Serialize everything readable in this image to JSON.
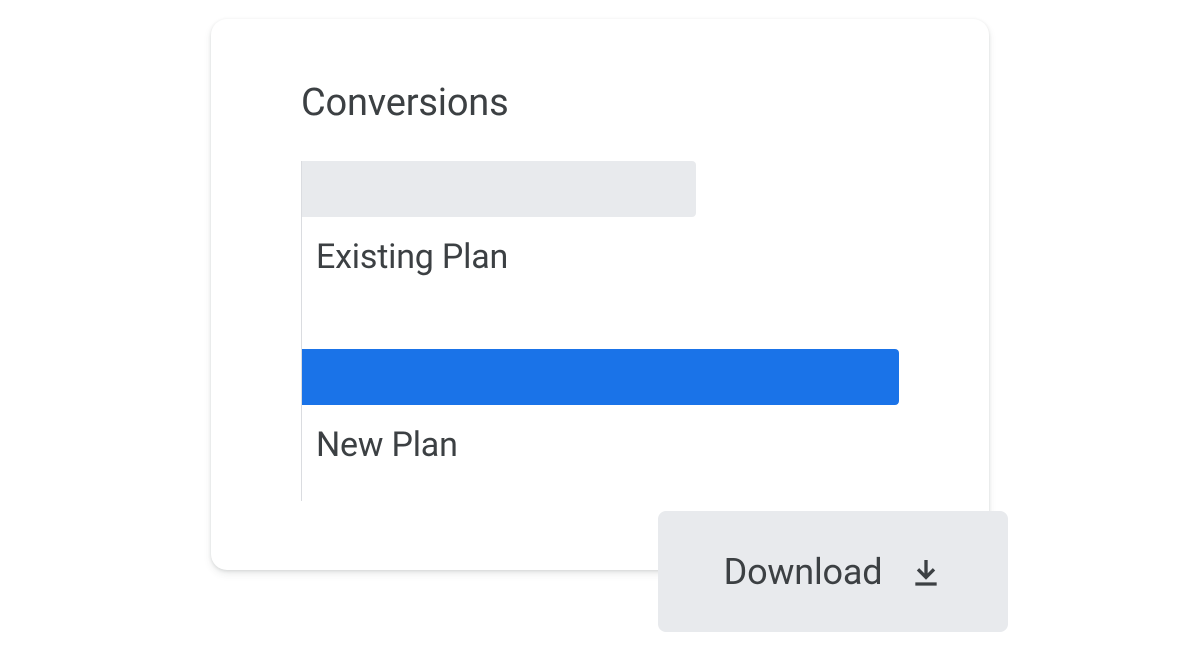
{
  "card": {
    "title": "Conversions"
  },
  "chart_data": {
    "type": "bar",
    "categories": [
      "Existing Plan",
      "New Plan"
    ],
    "values": [
      66,
      100
    ],
    "title": "Conversions",
    "xlabel": "",
    "ylabel": "",
    "series": [
      {
        "name": "Existing Plan",
        "value": 66,
        "color": "#e8eaed"
      },
      {
        "name": "New Plan",
        "value": 100,
        "color": "#1a73e8"
      }
    ]
  },
  "bars": {
    "existing": {
      "label": "Existing Plan",
      "width_pct": 66
    },
    "new": {
      "label": "New Plan",
      "width_pct": 100
    }
  },
  "download": {
    "label": "Download"
  }
}
